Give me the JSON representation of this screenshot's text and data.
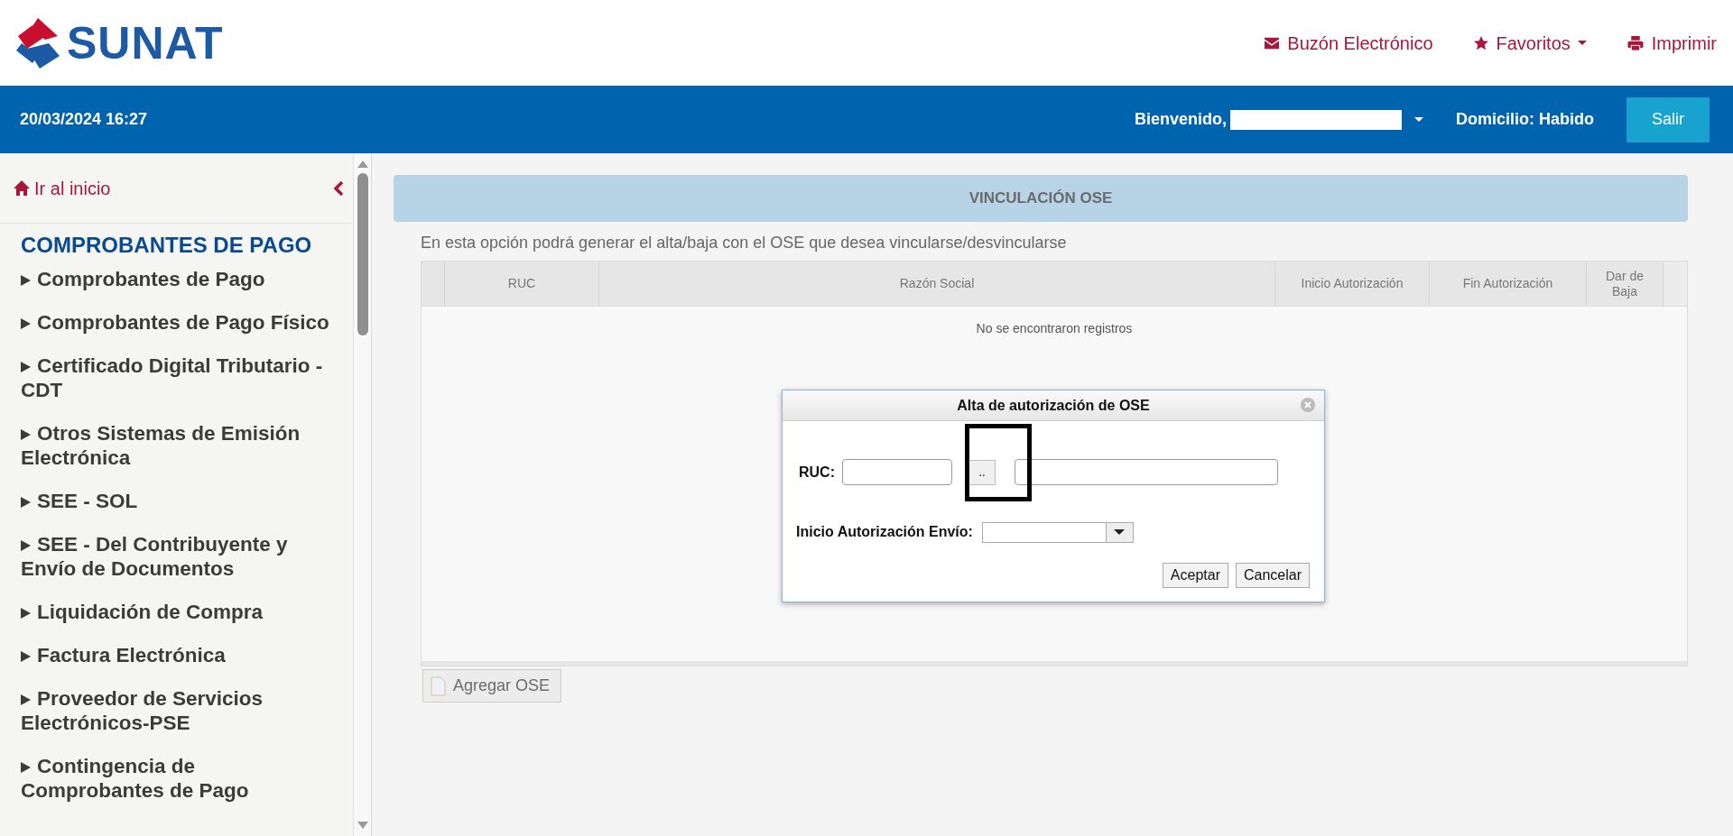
{
  "header": {
    "logo_text": "SUNAT",
    "links": [
      {
        "label": "Buzón Electrónico",
        "kind": "envelope",
        "dropdown": false
      },
      {
        "label": "Favoritos",
        "kind": "star",
        "dropdown": true
      },
      {
        "label": "Imprimir",
        "kind": "printer",
        "dropdown": false
      }
    ]
  },
  "bar": {
    "datetime": "20/03/2024 16:27",
    "welcome": "Bienvenido,",
    "domicilio": "Domicilio: Habido",
    "logout": "Salir"
  },
  "sidebar": {
    "home": "Ir al inicio",
    "section": "COMPROBANTES DE PAGO",
    "items": [
      {
        "label": "Comprobantes de Pago"
      },
      {
        "label": "Comprobantes de Pago Físico"
      },
      {
        "label": "Certificado Digital Tributario - CDT"
      },
      {
        "label": "Otros Sistemas de Emisión Electrónica"
      },
      {
        "label": "SEE - SOL"
      },
      {
        "label": "SEE - Del Contribuyente y Envío de Documentos"
      },
      {
        "label": "Liquidación de Compra"
      },
      {
        "label": "Factura Electrónica"
      },
      {
        "label": "Proveedor de Servicios Electrónicos-PSE"
      },
      {
        "label": "Contingencia de Comprobantes de Pago"
      }
    ]
  },
  "main": {
    "title": "VINCULACIÓN OSE",
    "description": "En esta opción podrá generar el alta/baja con el OSE que desea vincularse/desvincularse",
    "table": {
      "columns": [
        "RUC",
        "Razón Social",
        "Inicio Autorización",
        "Fin Autorización",
        "Dar de Baja"
      ],
      "empty_message": "No se encontraron registros"
    },
    "add_button": "Agregar OSE"
  },
  "dialog": {
    "title": "Alta de autorización de OSE",
    "ruc_label": "RUC:",
    "lookup_button": "..",
    "highlighted": true,
    "date_label": "Inicio Autorización Envío:",
    "buttons": [
      "Aceptar",
      "Cancelar"
    ]
  }
}
